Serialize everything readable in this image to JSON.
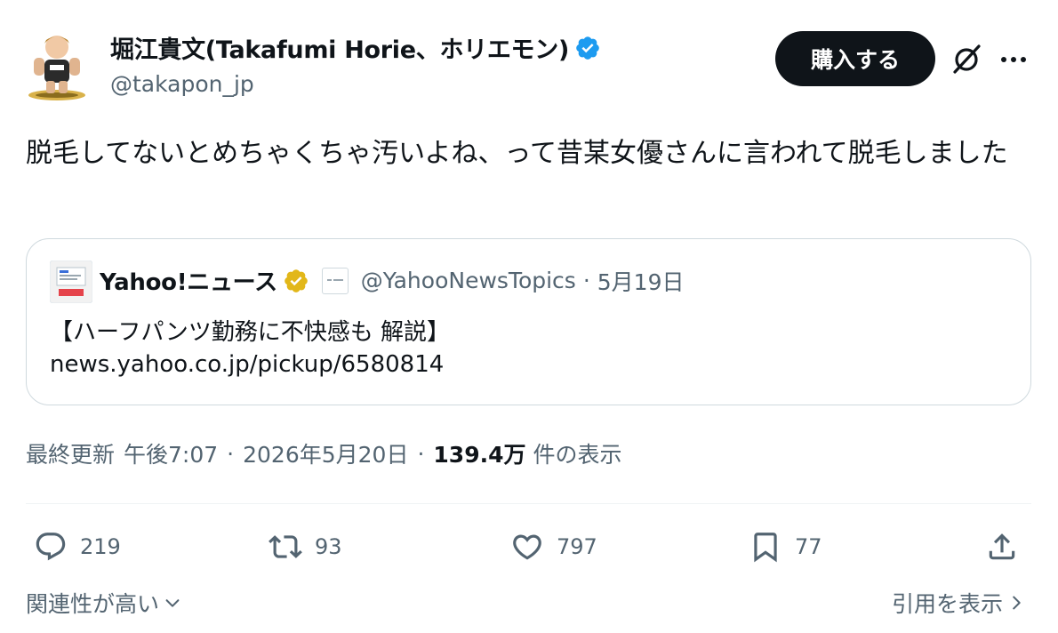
{
  "author": {
    "display_name": "堀江貴文(Takafumi Horie、ホリエモン)",
    "handle": "@takapon_jp",
    "verified": true
  },
  "header_actions": {
    "buy_label": "購入する",
    "grok_icon": "grok-icon",
    "more_icon": "more-icon"
  },
  "post": {
    "text": "脱毛してないとめちゃくちゃ汚いよね、って昔某女優さんに言われて脱毛しました"
  },
  "quote": {
    "name": "Yahoo!ニュース",
    "handle": "@YahooNewsTopics",
    "dot": "·",
    "date": "5月19日",
    "title": "【ハーフパンツ勤務に不快感も 解説】",
    "link": "news.yahoo.co.jp/pickup/6580814"
  },
  "meta": {
    "updated_label": "最終更新",
    "time": "午後7:07",
    "sep": "·",
    "date": "2026年5月20日",
    "views": "139.4万",
    "views_label": "件の表示"
  },
  "actions": {
    "replies": "219",
    "retweets": "93",
    "likes": "797",
    "bookmarks": "77"
  },
  "footer": {
    "sort_label": "関連性が高い",
    "quotes_label": "引用を表示"
  },
  "colors": {
    "text": "#0f1419",
    "secondary": "#536471",
    "verified_blue": "#1d9bf0",
    "verified_gold": "#e2b719",
    "border": "#cfd9de",
    "button_bg": "#0f1419"
  }
}
